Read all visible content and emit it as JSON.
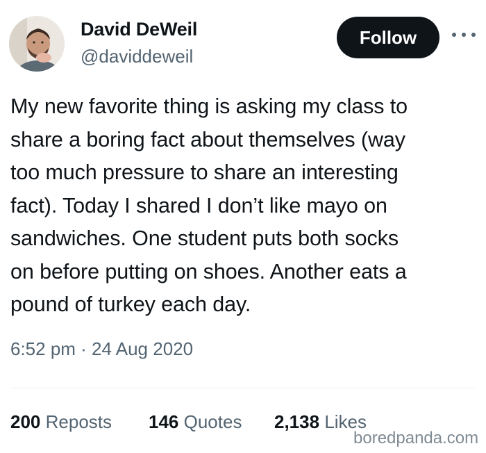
{
  "author": {
    "name": "David DeWeil",
    "handle": "@daviddeweil"
  },
  "actions": {
    "follow_label": "Follow",
    "more_icon": "more-horizontal-icon"
  },
  "tweet": {
    "lines": [
      "My new favorite thing is asking my class to",
      "share a boring fact about themselves (way",
      "too much pressure to share an interesting",
      "fact). Today I shared I don’t like mayo on",
      "sandwiches. One student puts both socks",
      "on before putting on shoes. Another eats a",
      "pound of turkey each day."
    ],
    "timestamp": "6:52 pm · 24 Aug 2020"
  },
  "stats": {
    "reposts_count": "200",
    "reposts_label": "Reposts",
    "quotes_count": "146",
    "quotes_label": "Quotes",
    "likes_count": "2,138",
    "likes_label": "Likes"
  },
  "watermark": "boredpanda.com",
  "colors": {
    "text_primary": "#0f1419",
    "text_secondary": "#536471",
    "button_bg": "#0f1419",
    "divider": "#eff3f4"
  }
}
